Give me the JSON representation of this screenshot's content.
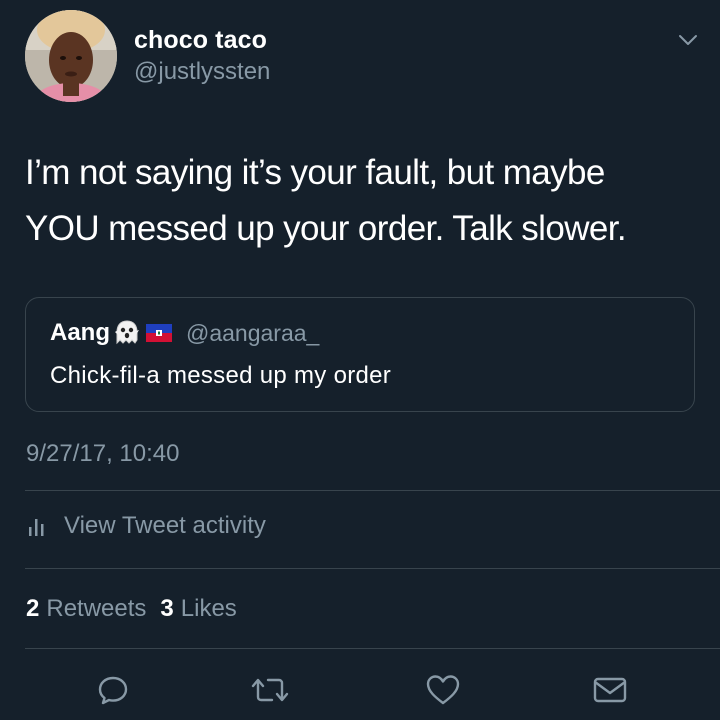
{
  "tweet": {
    "author": {
      "display_name": "choco taco",
      "handle": "@justlyssten"
    },
    "text_lines": [
      "I’m not saying it’s your fault, but maybe",
      "YOU messed up your order. Talk slower."
    ],
    "quoted": {
      "display_name": "Aang",
      "emoji_icon": "ghost-emoji-icon",
      "flag_icon": "haiti-flag-icon",
      "handle": "@aangaraa_",
      "text": "Chick-fil-a messed up my order"
    },
    "timestamp": "9/27/17, 10:40",
    "activity_label": "View Tweet activity",
    "stats": {
      "retweets_count": "2",
      "retweets_label": "Retweets",
      "likes_count": "3",
      "likes_label": "Likes"
    },
    "actions": [
      "reply-icon",
      "retweet-icon",
      "like-icon",
      "direct-message-icon"
    ]
  },
  "colors": {
    "background": "#15202b",
    "primary_text": "#ffffff",
    "secondary_text": "#8899a6",
    "border": "#38444d"
  }
}
